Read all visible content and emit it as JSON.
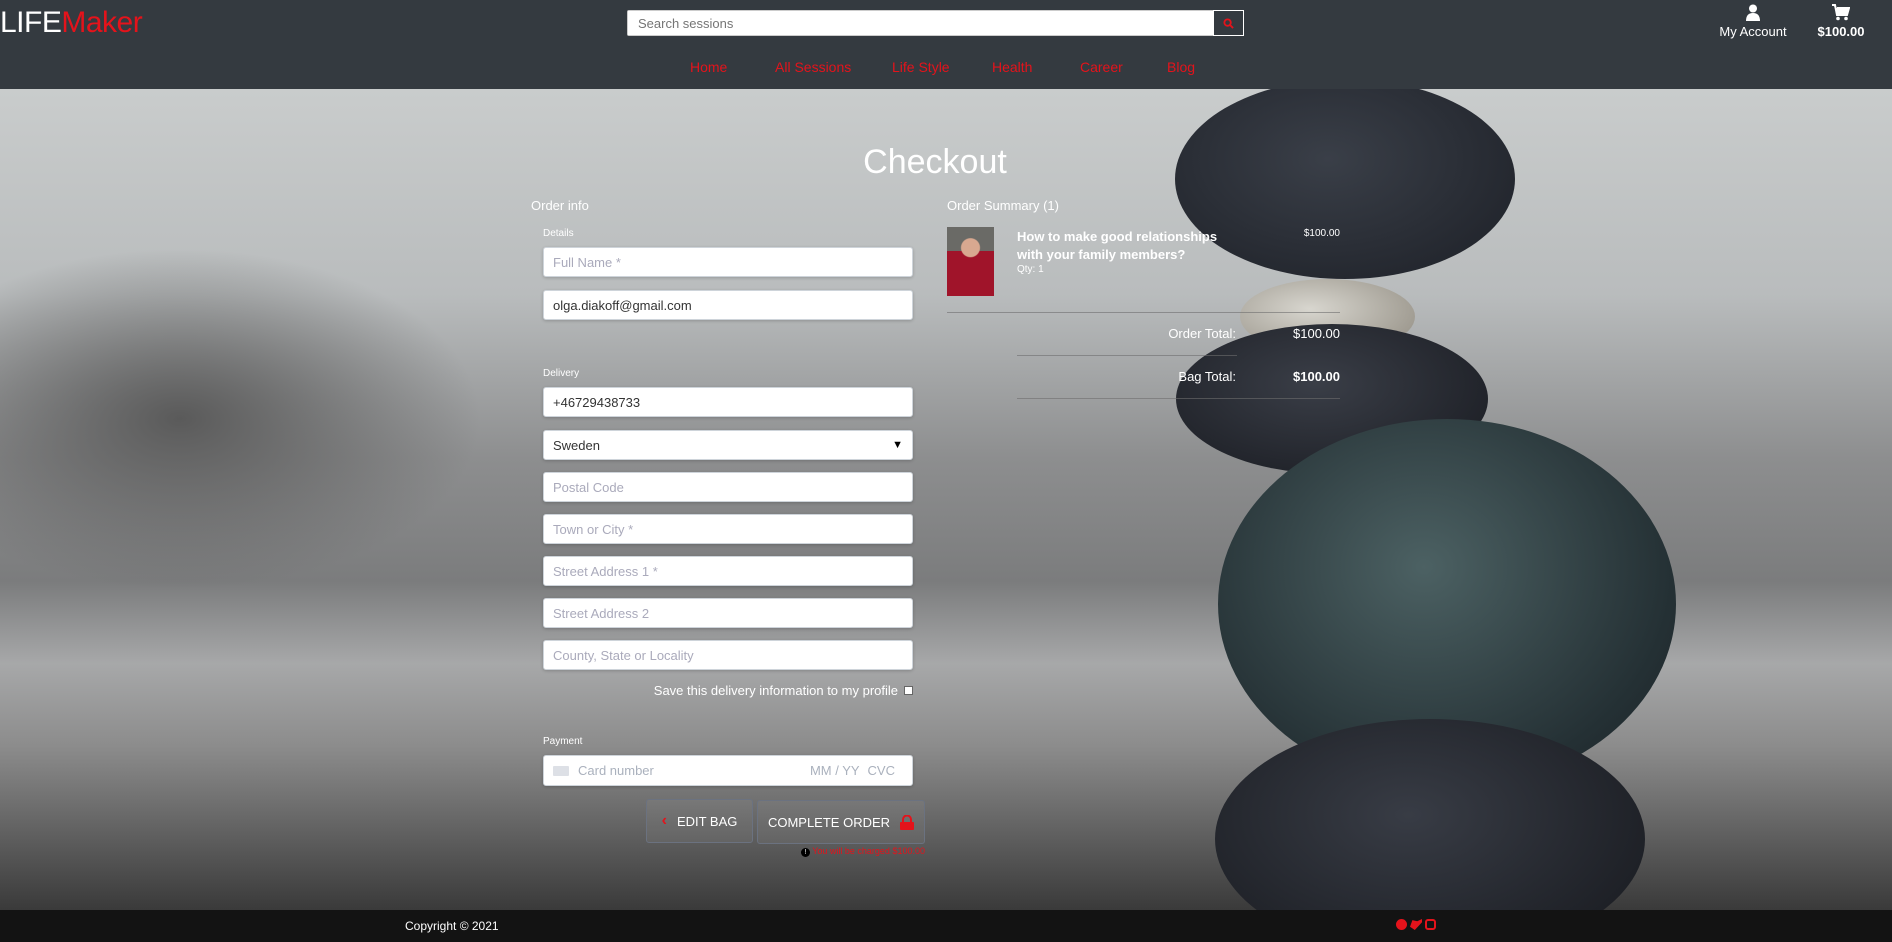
{
  "header": {
    "logo_part1": "LIFE",
    "logo_part2": "Maker",
    "search_placeholder": "Search sessions",
    "account_label": "My Account",
    "bag_total": "$100.00"
  },
  "nav": [
    "Home",
    "All Sessions",
    "Life Style",
    "Health",
    "Career",
    "Blog"
  ],
  "page_title": "Checkout",
  "order_info": {
    "heading": "Order info",
    "details_label": "Details",
    "full_name_placeholder": "Full Name *",
    "email_value": "olga.diakoff@gmail.com",
    "delivery_label": "Delivery",
    "phone_value": "+46729438733",
    "country_value": "Sweden",
    "postal_placeholder": "Postal Code",
    "town_placeholder": "Town or City *",
    "street1_placeholder": "Street Address 1 *",
    "street2_placeholder": "Street Address 2",
    "county_placeholder": "County, State or Locality",
    "save_label": "Save this delivery information to my profile",
    "payment_label": "Payment",
    "card_placeholder": "Card number",
    "card_exp": "MM / YY",
    "card_cvc": "CVC"
  },
  "buttons": {
    "edit_bag": "EDIT BAG",
    "complete_order": "COMPLETE ORDER"
  },
  "charge_notice": {
    "text": "You will be charged",
    "amount": "$100.00"
  },
  "summary": {
    "heading": "Order Summary (1)",
    "item_title_line1": "How to make good relationships",
    "item_title_line2": "with your family members?",
    "item_qty": "Qty: 1",
    "item_price": "$100.00",
    "order_total_label": "Order Total:",
    "order_total": "$100.00",
    "bag_total_label": "Bag Total:",
    "bag_total": "$100.00"
  },
  "footer": {
    "copyright": "Copyright © 2021"
  },
  "colors": {
    "accent": "#e4131b",
    "header_bg": "#343a40",
    "footer_bg": "#131313"
  }
}
